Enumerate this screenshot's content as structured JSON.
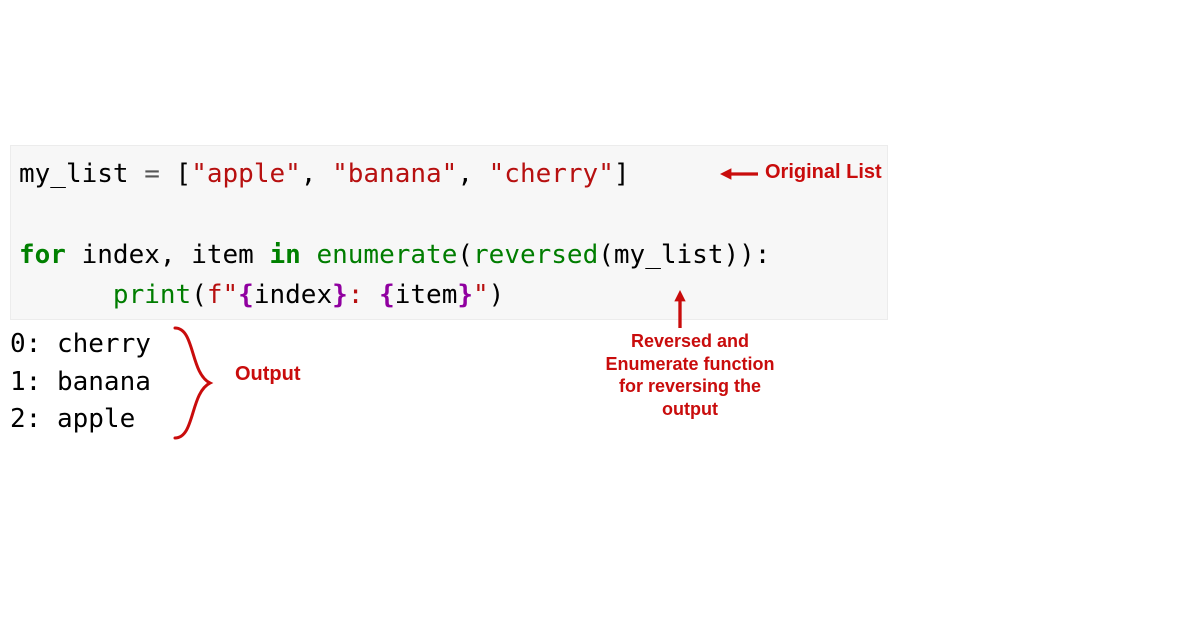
{
  "code": {
    "var_name": "my_list",
    "assign_op": " = ",
    "open_bracket": "[",
    "str1": "\"apple\"",
    "comma1": ", ",
    "str2": "\"banana\"",
    "comma2": ", ",
    "str3": "\"cherry\"",
    "close_bracket": "]",
    "for_kw": "for",
    "space": " ",
    "iter_index": "index",
    "comma3": ", ",
    "iter_item": "item",
    "in_kw": "in",
    "enumerate_fn": "enumerate",
    "open_paren1": "(",
    "reversed_fn": "reversed",
    "open_paren2": "(",
    "arg_list": "my_list",
    "close_paren2": ")",
    "close_paren1": ")",
    "colon": ":",
    "indent": "      ",
    "print_fn": "print",
    "open_paren3": "(",
    "fprefix": "f",
    "fstr_open": "\"",
    "si_open1": "{",
    "si_name1": "index",
    "si_close1": "}",
    "fstr_mid": ": ",
    "si_open2": "{",
    "si_name2": "item",
    "si_close2": "}",
    "fstr_close": "\"",
    "close_paren3": ")"
  },
  "output": {
    "line1": "0: cherry",
    "line2": "1: banana",
    "line3": "2: apple"
  },
  "annotations": {
    "original_list": "Original List",
    "output_label": "Output",
    "reversed_note": "Reversed and\nEnumerate function\nfor reversing the\noutput"
  },
  "colors": {
    "annotation_red": "#c90c0c",
    "code_bg": "#f7f7f7"
  }
}
